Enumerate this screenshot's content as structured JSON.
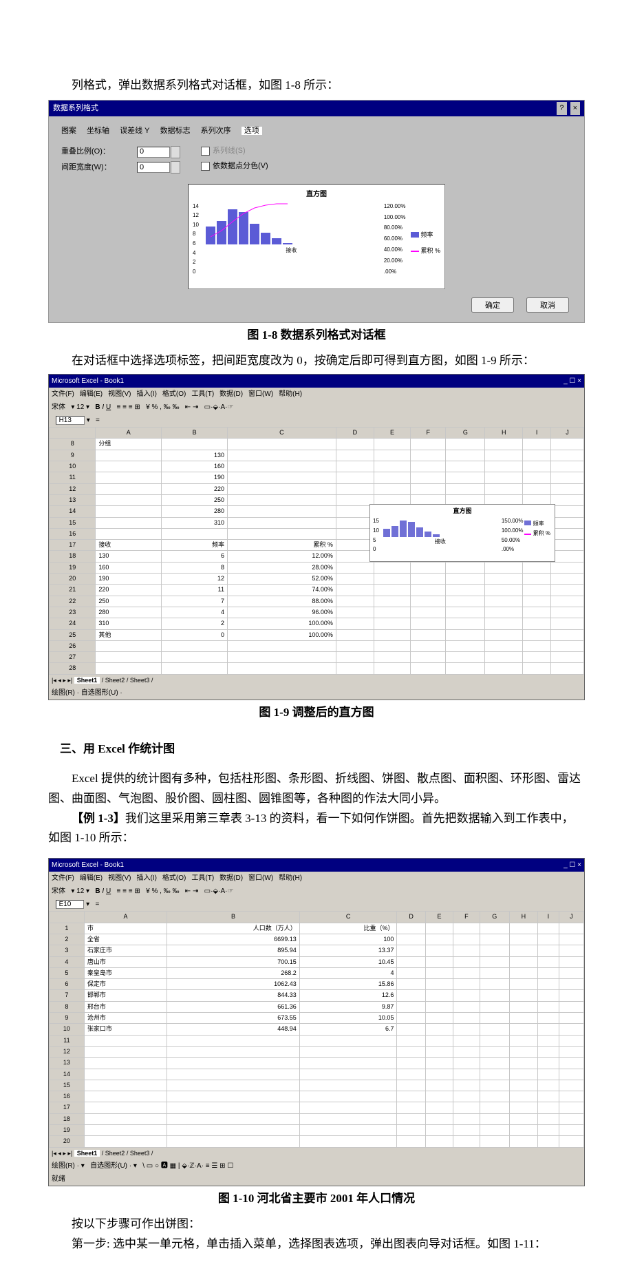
{
  "intro1": "列格式，弹出数据系列格式对话框，如图 1-8 所示：",
  "chart_data": [
    {
      "type": "bar",
      "title": "直方图",
      "categories": [
        "130",
        "160",
        "190",
        "220",
        "250",
        "280",
        "310",
        "其他"
      ],
      "values": [
        6,
        8,
        12,
        11,
        7,
        4,
        2,
        0
      ],
      "line_pct": [
        12,
        28,
        52,
        74,
        88,
        96,
        100,
        100
      ],
      "series": [
        {
          "name": "频率",
          "type": "bar",
          "values": [
            6,
            8,
            12,
            11,
            7,
            4,
            2,
            0
          ]
        },
        {
          "name": "累积 %",
          "type": "line",
          "values": [
            12,
            28,
            52,
            74,
            88,
            96,
            100,
            100
          ]
        }
      ],
      "ylabel_left": "频率",
      "ylabel_right": "%",
      "ylim_left": [
        0,
        14
      ],
      "ylim_right": [
        0,
        120
      ],
      "xlabel": "接收"
    },
    {
      "type": "table",
      "title": "河北省主要市2001年人口情况",
      "columns": [
        "市",
        "人口数（万人）",
        "比重（%）"
      ],
      "rows": [
        [
          "全省",
          6699.13,
          100
        ],
        [
          "石家庄市",
          895.94,
          13.37
        ],
        [
          "唐山市",
          700.15,
          10.45
        ],
        [
          "秦皇岛市",
          268.2,
          4
        ],
        [
          "保定市",
          1062.43,
          15.86
        ],
        [
          "邯郸市",
          844.33,
          12.6
        ],
        [
          "邢台市",
          661.36,
          9.87
        ],
        [
          "沧州市",
          673.55,
          10.05
        ],
        [
          "张家口市",
          448.94,
          6.7
        ]
      ]
    }
  ],
  "dlg18": {
    "title": "数据系列格式",
    "tabs": [
      "图案",
      "坐标轴",
      "误差线 Y",
      "数据标志",
      "系列次序",
      "选项"
    ],
    "selected_tab": "选项",
    "overlap_label": "重叠比例(O)：",
    "overlap_val": "0",
    "gap_label": "间距宽度(W)：",
    "gap_val": "0",
    "ck1": "系列线(S)",
    "ck2": "依数据点分色(V)",
    "chart_title": "直方图",
    "xlabel": "接收",
    "legend_a": "频率",
    "legend_b": "累积 %",
    "yticks": [
      "14",
      "12",
      "10",
      "8",
      "6",
      "4",
      "2",
      "0"
    ],
    "pct_ticks": [
      "120.00%",
      "100.00%",
      "80.00%",
      "60.00%",
      "40.00%",
      "20.00%",
      ".00%"
    ],
    "ok": "确定",
    "cancel": "取消"
  },
  "cap18": "图 1-8 数据系列格式对话框",
  "para2": "在对话框中选择选项标签，把间距宽度改为 0，按确定后即可得到直方图，如图 1-9 所示：",
  "excel1": {
    "title": "Microsoft Excel - Book1",
    "menus": [
      "文件(F)",
      "编辑(E)",
      "视图(V)",
      "插入(I)",
      "格式(O)",
      "工具(T)",
      "数据(D)",
      "窗口(W)",
      "帮助(H)"
    ],
    "font": "宋体",
    "size": "12",
    "cellref": "H13",
    "cols": [
      "",
      "A",
      "B",
      "C",
      "D",
      "E",
      "F",
      "G",
      "H",
      "I",
      "J"
    ],
    "rows": [
      [
        "8",
        "分组",
        "",
        "",
        "",
        "",
        "",
        "",
        "",
        "",
        ""
      ],
      [
        "9",
        "",
        "130",
        "",
        "",
        "",
        "",
        "",
        "",
        "",
        ""
      ],
      [
        "10",
        "",
        "160",
        "",
        "",
        "",
        "",
        "",
        "",
        "",
        ""
      ],
      [
        "11",
        "",
        "190",
        "",
        "",
        "",
        "",
        "",
        "",
        "",
        ""
      ],
      [
        "12",
        "",
        "220",
        "",
        "",
        "",
        "",
        "",
        "",
        "",
        ""
      ],
      [
        "13",
        "",
        "250",
        "",
        "",
        "",
        "",
        "",
        "",
        "",
        ""
      ],
      [
        "14",
        "",
        "280",
        "",
        "",
        "",
        "",
        "",
        "",
        "",
        ""
      ],
      [
        "15",
        "",
        "310",
        "",
        "",
        "",
        "",
        "",
        "",
        "",
        ""
      ],
      [
        "16",
        "",
        "",
        "",
        "",
        "",
        "",
        "",
        "",
        "",
        ""
      ],
      [
        "17",
        "接收",
        "频率",
        "累积 %",
        "",
        "",
        "",
        "",
        "",
        "",
        ""
      ],
      [
        "18",
        "130",
        "6",
        "12.00%",
        "",
        "",
        "",
        "",
        "",
        "",
        ""
      ],
      [
        "19",
        "160",
        "8",
        "28.00%",
        "",
        "",
        "",
        "",
        "",
        "",
        ""
      ],
      [
        "20",
        "190",
        "12",
        "52.00%",
        "",
        "",
        "",
        "",
        "",
        "",
        ""
      ],
      [
        "21",
        "220",
        "11",
        "74.00%",
        "",
        "",
        "",
        "",
        "",
        "",
        ""
      ],
      [
        "22",
        "250",
        "7",
        "88.00%",
        "",
        "",
        "",
        "",
        "",
        "",
        ""
      ],
      [
        "23",
        "280",
        "4",
        "96.00%",
        "",
        "",
        "",
        "",
        "",
        "",
        ""
      ],
      [
        "24",
        "310",
        "2",
        "100.00%",
        "",
        "",
        "",
        "",
        "",
        "",
        ""
      ],
      [
        "25",
        "其他",
        "0",
        "100.00%",
        "",
        "",
        "",
        "",
        "",
        "",
        ""
      ],
      [
        "26",
        "",
        "",
        "",
        "",
        "",
        "",
        "",
        "",
        "",
        ""
      ],
      [
        "27",
        "",
        "",
        "",
        "",
        "",
        "",
        "",
        "",
        "",
        ""
      ],
      [
        "28",
        "",
        "",
        "",
        "",
        "",
        "",
        "",
        "",
        "",
        ""
      ]
    ],
    "inchart": {
      "title": "直方图",
      "xlabel": "接收",
      "leg1": "频率",
      "leg2": "累积 %",
      "pct": [
        "150.00%",
        "100.00%",
        "50.00%",
        ".00%"
      ],
      "yt": [
        "15",
        "10",
        "5",
        "0"
      ]
    },
    "sheets": [
      "Sheet1",
      "Sheet2",
      "Sheet3"
    ],
    "drawbar": "绘图(R) ·  自选图形(U) ·"
  },
  "cap19": "图 1-9 调整后的直方图",
  "sec3": "三、用 Excel 作统计图",
  "para3": "Excel 提供的统计图有多种，包括柱形图、条形图、折线图、饼图、散点图、面积图、环形图、雷达图、曲面图、气泡图、股价图、圆柱图、圆锥图等，各种图的作法大同小异。",
  "ex13_a": "【例 1-3】",
  "ex13_b": "我们这里采用第三章表 3-13 的资料，看一下如何作饼图。首先把数据输入到工作表中，如图 1-10 所示：",
  "excel2": {
    "title": "Microsoft Excel - Book1",
    "menus": [
      "文件(F)",
      "编辑(E)",
      "视图(V)",
      "插入(I)",
      "格式(O)",
      "工具(T)",
      "数据(D)",
      "窗口(W)",
      "帮助(H)"
    ],
    "font": "宋体",
    "size": "12",
    "cellref": "E10",
    "cols": [
      "",
      "A",
      "B",
      "C",
      "D",
      "E",
      "F",
      "G",
      "H",
      "I",
      "J"
    ],
    "rows": [
      [
        "1",
        "市",
        "人口数（万人）",
        "比重（%）",
        "",
        "",
        "",
        "",
        "",
        "",
        ""
      ],
      [
        "2",
        "全省",
        "6699.13",
        "100",
        "",
        "",
        "",
        "",
        "",
        "",
        ""
      ],
      [
        "3",
        "石家庄市",
        "895.94",
        "13.37",
        "",
        "",
        "",
        "",
        "",
        "",
        ""
      ],
      [
        "4",
        "唐山市",
        "700.15",
        "10.45",
        "",
        "",
        "",
        "",
        "",
        "",
        ""
      ],
      [
        "5",
        "秦皇岛市",
        "268.2",
        "4",
        "",
        "",
        "",
        "",
        "",
        "",
        ""
      ],
      [
        "6",
        "保定市",
        "1062.43",
        "15.86",
        "",
        "",
        "",
        "",
        "",
        "",
        ""
      ],
      [
        "7",
        "邯郸市",
        "844.33",
        "12.6",
        "",
        "",
        "",
        "",
        "",
        "",
        ""
      ],
      [
        "8",
        "邢台市",
        "661.36",
        "9.87",
        "",
        "",
        "",
        "",
        "",
        "",
        ""
      ],
      [
        "9",
        "沧州市",
        "673.55",
        "10.05",
        "",
        "",
        "",
        "",
        "",
        "",
        ""
      ],
      [
        "10",
        "张家口市",
        "448.94",
        "6.7",
        "",
        "",
        "",
        "",
        "",
        "",
        ""
      ],
      [
        "11",
        "",
        "",
        "",
        "",
        "",
        "",
        "",
        "",
        "",
        ""
      ],
      [
        "12",
        "",
        "",
        "",
        "",
        "",
        "",
        "",
        "",
        "",
        ""
      ],
      [
        "13",
        "",
        "",
        "",
        "",
        "",
        "",
        "",
        "",
        "",
        ""
      ],
      [
        "14",
        "",
        "",
        "",
        "",
        "",
        "",
        "",
        "",
        "",
        ""
      ],
      [
        "15",
        "",
        "",
        "",
        "",
        "",
        "",
        "",
        "",
        "",
        ""
      ],
      [
        "16",
        "",
        "",
        "",
        "",
        "",
        "",
        "",
        "",
        "",
        ""
      ],
      [
        "17",
        "",
        "",
        "",
        "",
        "",
        "",
        "",
        "",
        "",
        ""
      ],
      [
        "18",
        "",
        "",
        "",
        "",
        "",
        "",
        "",
        "",
        "",
        ""
      ],
      [
        "19",
        "",
        "",
        "",
        "",
        "",
        "",
        "",
        "",
        "",
        ""
      ],
      [
        "20",
        "",
        "",
        "",
        "",
        "",
        "",
        "",
        "",
        "",
        ""
      ]
    ],
    "sheets": [
      "Sheet1",
      "Sheet2",
      "Sheet3"
    ],
    "status": "就绪"
  },
  "cap110": "图 1-10 河北省主要市 2001 年人口情况",
  "para5": "按以下步骤可作出饼图：",
  "para6": "第一步: 选中某一单元格，单击插入菜单，选择图表选项，弹出图表向导对话框。如图 1-11："
}
